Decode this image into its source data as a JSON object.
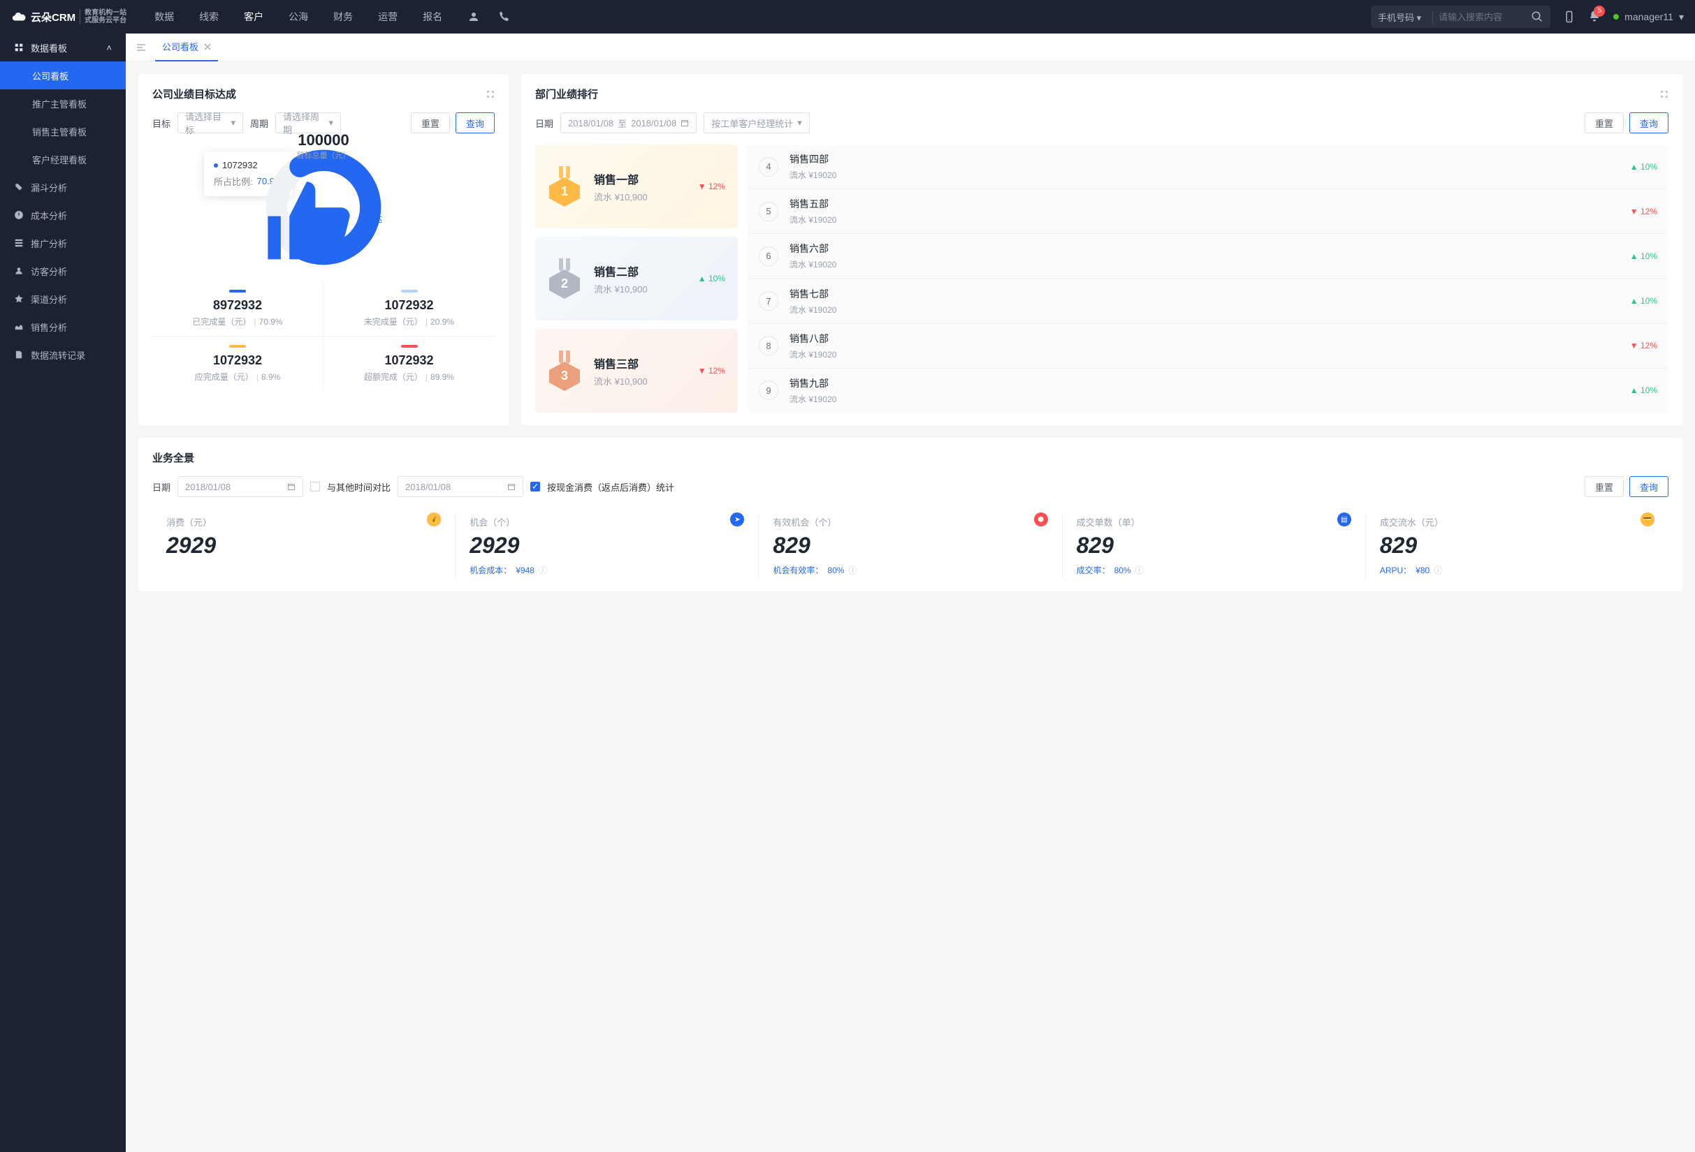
{
  "topnav": {
    "logo": "云朵CRM",
    "logo_sub1": "教育机构一站",
    "logo_sub2": "式服务云平台",
    "items": [
      "数据",
      "线索",
      "客户",
      "公海",
      "财务",
      "运营",
      "报名"
    ],
    "active_index": 2,
    "search_type": "手机号码",
    "search_placeholder": "请输入搜索内容",
    "notif_count": "5",
    "username": "manager11"
  },
  "sidebar": {
    "group_title": "数据看板",
    "children": [
      "公司看板",
      "推广主管看板",
      "销售主管看板",
      "客户经理看板"
    ],
    "active_child_index": 0,
    "items": [
      "漏斗分析",
      "成本分析",
      "推广分析",
      "访客分析",
      "渠道分析",
      "销售分析",
      "数据流转记录"
    ]
  },
  "tabs": {
    "active": "公司看板"
  },
  "goal_card": {
    "title": "公司业绩目标达成",
    "filter_goal_label": "目标",
    "filter_goal_placeholder": "请选择目标",
    "filter_period_label": "周期",
    "filter_period_placeholder": "请选择周期",
    "btn_reset": "重置",
    "btn_query": "查询",
    "tooltip_value": "1072932",
    "tooltip_ratio_label": "所占比例:",
    "tooltip_ratio_value": "70.9%",
    "total": "100000",
    "total_label": "目标总量（元）",
    "achieved_label": "已达成",
    "metrics": [
      {
        "color": "#2468f2",
        "value": "8972932",
        "label": "已完成量（元）",
        "pct": "70.9%"
      },
      {
        "color": "#b3d4ff",
        "value": "1072932",
        "label": "未完成量（元）",
        "pct": "20.9%"
      },
      {
        "color": "#ffb946",
        "value": "1072932",
        "label": "应完成量（元）",
        "pct": "8.9%"
      },
      {
        "color": "#ff5050",
        "value": "1072932",
        "label": "超额完成（元）",
        "pct": "89.9%"
      }
    ]
  },
  "rank_card": {
    "title": "部门业绩排行",
    "filter_date_label": "日期",
    "date_from": "2018/01/08",
    "date_sep": "至",
    "date_to": "2018/01/08",
    "stat_label": "按工单客户经理统计",
    "btn_reset": "重置",
    "btn_query": "查询",
    "top3": [
      {
        "rank": "1",
        "name": "销售一部",
        "rev": "流水 ¥10,900",
        "delta": "12%",
        "dir": "down"
      },
      {
        "rank": "2",
        "name": "销售二部",
        "rev": "流水 ¥10,900",
        "delta": "10%",
        "dir": "up"
      },
      {
        "rank": "3",
        "name": "销售三部",
        "rev": "流水 ¥10,900",
        "delta": "12%",
        "dir": "down"
      }
    ],
    "others": [
      {
        "rank": "4",
        "name": "销售四部",
        "rev": "流水 ¥19020",
        "delta": "10%",
        "dir": "up"
      },
      {
        "rank": "5",
        "name": "销售五部",
        "rev": "流水 ¥19020",
        "delta": "12%",
        "dir": "down"
      },
      {
        "rank": "6",
        "name": "销售六部",
        "rev": "流水 ¥19020",
        "delta": "10%",
        "dir": "up"
      },
      {
        "rank": "7",
        "name": "销售七部",
        "rev": "流水 ¥19020",
        "delta": "10%",
        "dir": "up"
      },
      {
        "rank": "8",
        "name": "销售八部",
        "rev": "流水 ¥19020",
        "delta": "12%",
        "dir": "down"
      },
      {
        "rank": "9",
        "name": "销售九部",
        "rev": "流水 ¥19020",
        "delta": "10%",
        "dir": "up"
      }
    ]
  },
  "panorama_card": {
    "title": "业务全景",
    "filter_date_label": "日期",
    "date1": "2018/01/08",
    "compare_label": "与其他时间对比",
    "date2": "2018/01/08",
    "cash_label": "按现金消费（返点后消费）统计",
    "btn_reset": "重置",
    "btn_query": "查询",
    "metrics": [
      {
        "label": "消费（元）",
        "value": "2929",
        "sub_label": "",
        "sub_value": "",
        "icon_color": "#ffb946",
        "icon": "bag-icon"
      },
      {
        "label": "机会（个）",
        "value": "2929",
        "sub_label": "机会成本：",
        "sub_value": "¥948",
        "icon_color": "#2468f2",
        "icon": "plane-icon"
      },
      {
        "label": "有效机会（个）",
        "value": "829",
        "sub_label": "机会有效率：",
        "sub_value": "80%",
        "icon_color": "#ff5050",
        "icon": "shield-icon"
      },
      {
        "label": "成交单数（单）",
        "value": "829",
        "sub_label": "成交率：",
        "sub_value": "80%",
        "icon_color": "#2468f2",
        "icon": "doc-icon"
      },
      {
        "label": "成交流水（元）",
        "value": "829",
        "sub_label": "ARPU：",
        "sub_value": "¥80",
        "icon_color": "#ffb946",
        "icon": "card-icon"
      }
    ]
  },
  "chart_data": {
    "type": "donut",
    "title": "公司业绩目标达成",
    "total_label": "目标总量（元）",
    "total": 100000,
    "series": [
      {
        "name": "已完成量（元）",
        "value": 8972932,
        "pct": 70.9,
        "color": "#2468f2"
      },
      {
        "name": "未完成量（元）",
        "value": 1072932,
        "pct": 20.9,
        "color": "#b3d4ff"
      },
      {
        "name": "应完成量（元）",
        "value": 1072932,
        "pct": 8.9,
        "color": "#ffb946"
      },
      {
        "name": "超额完成（元）",
        "value": 1072932,
        "pct": 89.9,
        "color": "#ff5050"
      }
    ],
    "tooltip": {
      "value": 1072932,
      "ratio_pct": 70.9
    },
    "achieved": true
  }
}
